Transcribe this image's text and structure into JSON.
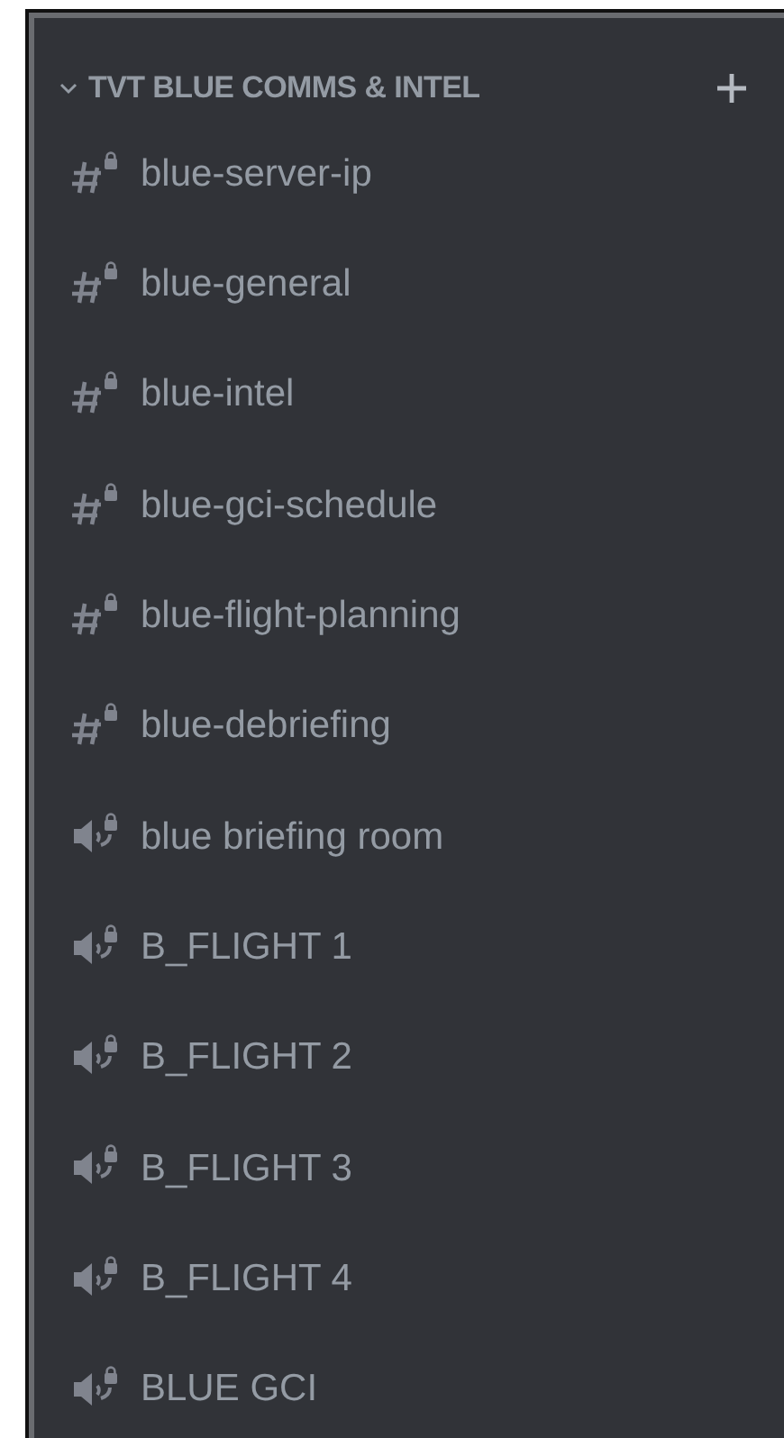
{
  "category": {
    "title": "TVT BLUE COMMS & INTEL",
    "expanded": true
  },
  "channels": [
    {
      "kind": "text",
      "name": "blue-server-ip"
    },
    {
      "kind": "text",
      "name": "blue-general"
    },
    {
      "kind": "text",
      "name": "blue-intel"
    },
    {
      "kind": "text",
      "name": "blue-gci-schedule"
    },
    {
      "kind": "text",
      "name": "blue-flight-planning"
    },
    {
      "kind": "text",
      "name": "blue-debriefing"
    },
    {
      "kind": "voice",
      "name": "blue briefing room"
    },
    {
      "kind": "voice",
      "name": "B_FLIGHT 1"
    },
    {
      "kind": "voice",
      "name": "B_FLIGHT 2"
    },
    {
      "kind": "voice",
      "name": "B_FLIGHT 3"
    },
    {
      "kind": "voice",
      "name": "B_FLIGHT 4"
    },
    {
      "kind": "voice",
      "name": "BLUE GCI"
    }
  ]
}
